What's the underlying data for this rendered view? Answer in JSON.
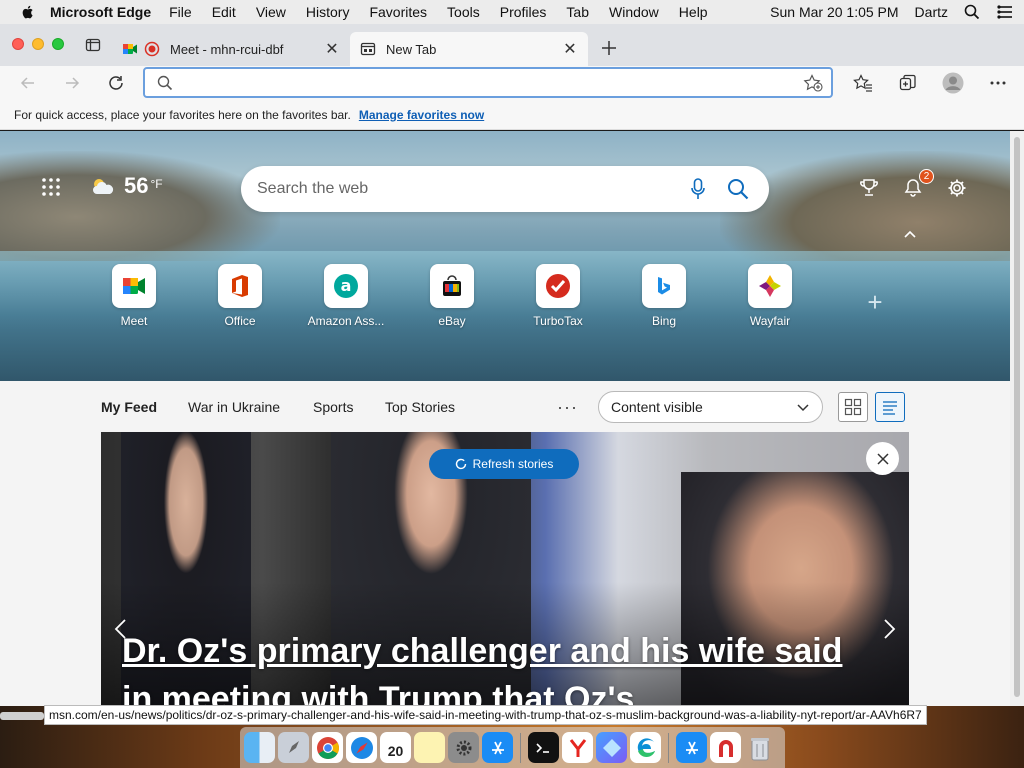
{
  "menubar": {
    "app_name": "Microsoft Edge",
    "items": [
      "File",
      "Edit",
      "View",
      "History",
      "Favorites",
      "Tools",
      "Profiles",
      "Tab",
      "Window",
      "Help"
    ],
    "datetime": "Sun Mar 20  1:05 PM",
    "user": "Dartz"
  },
  "tabs": [
    {
      "title": "Meet - mhn-rcui-dbf",
      "active": false
    },
    {
      "title": "New Tab",
      "active": true
    }
  ],
  "address_bar": {
    "value": ""
  },
  "favorites_bar": {
    "message": "For quick access, place your favorites here on the favorites bar.",
    "link": "Manage favorites now"
  },
  "newtab": {
    "weather": {
      "temp": "56",
      "unit": "°F"
    },
    "search_placeholder": "Search the web",
    "notification_count": "2",
    "quick_links": [
      {
        "label": "Meet"
      },
      {
        "label": "Office"
      },
      {
        "label": "Amazon Ass..."
      },
      {
        "label": "eBay"
      },
      {
        "label": "TurboTax"
      },
      {
        "label": "Bing"
      },
      {
        "label": "Wayfair"
      }
    ]
  },
  "feed": {
    "tabs": [
      "My Feed",
      "War in Ukraine",
      "Sports",
      "Top Stories"
    ],
    "selected_tab": "My Feed",
    "more": "···",
    "content_visibility": "Content visible",
    "refresh_label": "Refresh stories",
    "headline": "Dr. Oz's primary challenger and his wife said in meeting with Trump that Oz's"
  },
  "status_url": "msn.com/en-us/news/politics/dr-oz-s-primary-challenger-and-his-wife-said-in-meeting-with-trump-that-oz-s-muslim-background-was-a-liability-nyt-report/ar-AAVh6R7",
  "dock": {
    "calendar_day": "20"
  },
  "colors": {
    "accent": "#0f6cbd",
    "badge": "#e0531d",
    "address_focus": "#6b9fde"
  }
}
